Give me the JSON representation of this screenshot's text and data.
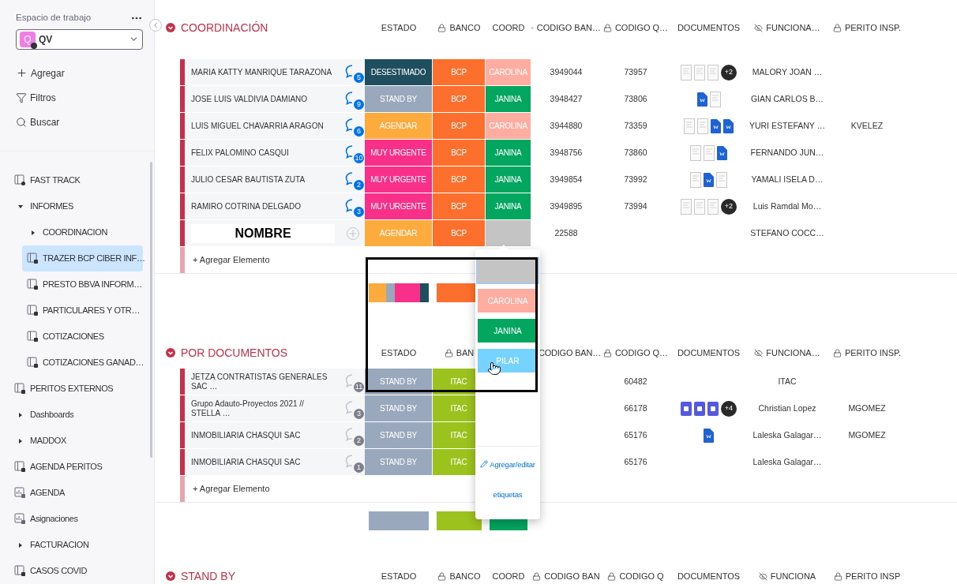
{
  "sidebar": {
    "workspace_label": "Espacio de trabajo",
    "workspace": {
      "initial": "Q",
      "name": "QV"
    },
    "actions": [
      {
        "kind": "add",
        "label": "Agregar"
      },
      {
        "kind": "filter",
        "label": "Filtros"
      },
      {
        "kind": "search",
        "label": "Buscar"
      }
    ],
    "items": [
      {
        "kind": "shared_board",
        "label": "FAST TRACK",
        "selected": false
      },
      {
        "kind": "folder",
        "label": "INFORMES",
        "expanded": true,
        "selected": false,
        "children": [
          {
            "kind": "folder",
            "label": "COORDINACION",
            "expanded": false,
            "selected": false
          },
          {
            "kind": "board",
            "label": "TRAZER BCP CIBER INF…",
            "selected": true
          },
          {
            "kind": "board",
            "label": "PRESTO BBVA INFORM…",
            "selected": false
          },
          {
            "kind": "board",
            "label": "PARTICULARES Y OTR…",
            "selected": false
          },
          {
            "kind": "board",
            "label": "COTIZACIONES",
            "selected": false
          },
          {
            "kind": "board",
            "label": "COTIZACIONES GANAD…",
            "selected": false
          }
        ]
      },
      {
        "kind": "board",
        "label": "PERITOS EXTERNOS",
        "selected": false
      },
      {
        "kind": "folder",
        "label": "Dashboards",
        "expanded": false,
        "selected": false
      },
      {
        "kind": "folder",
        "label": "MADDOX",
        "expanded": false,
        "selected": false
      },
      {
        "kind": "board",
        "label": "AGENDA PERITOS",
        "selected": false
      },
      {
        "kind": "dashboard",
        "label": "AGENDA",
        "selected": false
      },
      {
        "kind": "dashboard",
        "label": "Asignaciones",
        "selected": false
      },
      {
        "kind": "folder",
        "label": "FACTURACION",
        "expanded": false,
        "selected": false
      },
      {
        "kind": "board",
        "label": "CASOS COVID",
        "selected": false
      }
    ]
  },
  "groups": [
    {
      "title": "COORDINACIÓN",
      "color": "#c4314b",
      "columns": [
        {
          "label": "ESTADO",
          "locked": false,
          "hidden": false
        },
        {
          "label": "BANCO",
          "locked": true,
          "hidden": false
        },
        {
          "label": "COORD",
          "locked": false,
          "hidden": false
        },
        {
          "label": "CODIGO BAN…",
          "locked": true,
          "hidden": false
        },
        {
          "label": "CODIGO Q…",
          "locked": true,
          "hidden": false
        },
        {
          "label": "DOCUMENTOS",
          "locked": false,
          "hidden": false
        },
        {
          "label": "FUNCIONA…",
          "locked": false,
          "hidden": true
        },
        {
          "label": "PERITO INSP.",
          "locked": true,
          "hidden": false
        }
      ],
      "rows": [
        {
          "name": "MARIA KATTY MANRIQUE TARAZONA",
          "editing": false,
          "comments": {
            "count": "5",
            "active": true
          },
          "estado": {
            "label": "DESESTIMADO",
            "color": "#1f4e5f"
          },
          "banco": {
            "label": "BCP",
            "color": "#fd6f2c"
          },
          "coord": {
            "label": "CAROLINA",
            "color": "#ffada1"
          },
          "codigo_ban": "3949044",
          "codigo_q": "73957",
          "docs": [
            {
              "kind": "page"
            },
            {
              "kind": "page"
            },
            {
              "kind": "page"
            }
          ],
          "docs_more": "+2",
          "funcionario": "MALORY JOAN …"
        },
        {
          "name": "JOSE LUIS VALDIVIA DAMIANO",
          "editing": false,
          "comments": {
            "count": "9",
            "active": true
          },
          "estado": {
            "label": "STAND BY",
            "color": "#9aa8bd"
          },
          "banco": {
            "label": "BCP",
            "color": "#fd6f2c"
          },
          "coord": {
            "label": "JANINA",
            "color": "#03a65f"
          },
          "codigo_ban": "3948427",
          "codigo_q": "73806",
          "docs": [
            {
              "kind": "word"
            },
            {
              "kind": "page"
            }
          ],
          "funcionario": "GIAN CARLOS B…"
        },
        {
          "name": "LUIS MIGUEL CHAVARRIA ARAGON",
          "editing": false,
          "comments": {
            "count": "6",
            "active": true
          },
          "estado": {
            "label": "AGENDAR",
            "color": "#fdab3d"
          },
          "banco": {
            "label": "BCP",
            "color": "#fd6f2c"
          },
          "coord": {
            "label": "CAROLINA",
            "color": "#ffada1"
          },
          "codigo_ban": "3944880",
          "codigo_q": "73359",
          "docs": [
            {
              "kind": "page"
            },
            {
              "kind": "page"
            },
            {
              "kind": "word"
            },
            {
              "kind": "word"
            }
          ],
          "funcionario": "YURI ESTEFANY …",
          "perito": "KVELEZ"
        },
        {
          "name": "FELIX PALOMINO CASQUI",
          "editing": false,
          "comments": {
            "count": "10",
            "active": true
          },
          "estado": {
            "label": "MUY URGENTE",
            "color": "#f9308a"
          },
          "banco": {
            "label": "BCP",
            "color": "#fd6f2c"
          },
          "coord": {
            "label": "JANINA",
            "color": "#03a65f"
          },
          "codigo_ban": "3948756",
          "codigo_q": "73860",
          "docs": [
            {
              "kind": "page"
            },
            {
              "kind": "page"
            },
            {
              "kind": "word"
            }
          ],
          "funcionario": "FERNANDO JUN…"
        },
        {
          "name": "JULIO CESAR BAUTISTA ZUTA",
          "editing": false,
          "comments": {
            "count": "2",
            "active": true
          },
          "estado": {
            "label": "MUY URGENTE",
            "color": "#f9308a"
          },
          "banco": {
            "label": "BCP",
            "color": "#fd6f2c"
          },
          "coord": {
            "label": "JANINA",
            "color": "#03a65f"
          },
          "codigo_ban": "3949854",
          "codigo_q": "73992",
          "docs": [
            {
              "kind": "page"
            },
            {
              "kind": "word"
            },
            {
              "kind": "page"
            }
          ],
          "funcionario": "YAMALI ISELA D…"
        },
        {
          "name": "RAMIRO COTRINA DELGADO",
          "editing": false,
          "comments": {
            "count": "3",
            "active": true
          },
          "estado": {
            "label": "MUY URGENTE",
            "color": "#f9308a"
          },
          "banco": {
            "label": "BCP",
            "color": "#fd6f2c"
          },
          "coord": {
            "label": "JANINA",
            "color": "#03a65f"
          },
          "codigo_ban": "3949895",
          "codigo_q": "73994",
          "docs": [
            {
              "kind": "page"
            },
            {
              "kind": "page"
            },
            {
              "kind": "page"
            }
          ],
          "docs_more": "+2",
          "funcionario": "Luis Ramdal Mo…"
        },
        {
          "name": "NOMBRE",
          "editing": true,
          "estado": {
            "label": "AGENDAR",
            "color": "#fdab3d"
          },
          "banco": {
            "label": "BCP",
            "color": "#fd6f2c"
          },
          "coord": {
            "color": "#c4c4c4"
          },
          "codigo_ban": "22588",
          "funcionario": "STEFANO COCC…"
        }
      ],
      "add_label": "+ Agregar Elemento",
      "summary": {
        "estado": [
          {
            "color": "#fdab3d"
          },
          {
            "color": "#9aa8bd"
          },
          {
            "color": "#f9308a"
          },
          {
            "color": "#1f4e5f"
          }
        ],
        "banco": [
          {
            "color": "#fd6f2c"
          }
        ]
      }
    },
    {
      "title": "POR DOCUMENTOS",
      "color": "#c4314b",
      "columns": [
        {
          "label": "ESTADO",
          "locked": false,
          "hidden": false
        },
        {
          "label": "BAN",
          "locked": true,
          "hidden": false
        },
        {
          "label": "CODIGO BAN…"
        },
        {
          "label": "CODIGO Q…",
          "locked": true,
          "hidden": false
        },
        {
          "label": "DOCUMENTOS",
          "locked": false,
          "hidden": false
        },
        {
          "label": "FUNCIONA…",
          "locked": false,
          "hidden": true
        },
        {
          "label": "PERITO INSP.",
          "locked": true,
          "hidden": false
        }
      ],
      "rows": [
        {
          "name": "JETZA CONTRATISTAS GENERALES SAC …",
          "editing": false,
          "comments": {
            "count": "11",
            "active": false
          },
          "estado": {
            "label": "STAND BY",
            "color": "#9aa8bd"
          },
          "banco": {
            "label": "ITAC",
            "color": "#9cc21d"
          },
          "codigo_q": "60482",
          "funcionario": "ITAC"
        },
        {
          "name": "Grupo Adauto-Proyectos 2021 // STELLA …",
          "editing": false,
          "comments": {
            "count": "3",
            "active": false
          },
          "estado": {
            "label": "STAND BY",
            "color": "#9aa8bd"
          },
          "banco": {
            "label": "ITAC",
            "color": "#9cc21d"
          },
          "codigo_q": "66178",
          "docs": [
            {
              "kind": "gdoc"
            },
            {
              "kind": "gdoc"
            },
            {
              "kind": "gdoc"
            }
          ],
          "docs_more": "+4",
          "funcionario": "Christian Lopez",
          "perito": "MGOMEZ"
        },
        {
          "name": "INMOBILIARIA CHASQUI SAC",
          "editing": false,
          "comments": {
            "count": "2",
            "active": false
          },
          "estado": {
            "label": "STAND BY",
            "color": "#9aa8bd"
          },
          "banco": {
            "label": "ITAC",
            "color": "#9cc21d"
          },
          "codigo_q": "65176",
          "docs": [
            {
              "kind": "word"
            }
          ],
          "funcionario": "Laleska Galagar…",
          "perito": "MGOMEZ"
        },
        {
          "name": "INMOBILIARIA CHASQUI SAC",
          "editing": false,
          "comments": {
            "count": "1",
            "active": false
          },
          "estado": {
            "label": "STAND BY",
            "color": "#9aa8bd"
          },
          "banco": {
            "label": "ITAC",
            "color": "#9cc21d"
          },
          "codigo_q": "65176",
          "funcionario": "Laleska Galagar…"
        }
      ],
      "add_label": "+ Agregar Elemento",
      "summary": {
        "estado": [
          {
            "color": "#9aa8bd"
          }
        ],
        "banco": [
          {
            "color": "#9cc21d"
          }
        ],
        "coord": [
          {
            "color": "#03a65f"
          }
        ]
      }
    },
    {
      "title": "STAND BY",
      "color": "#c4314b",
      "columns": [
        {
          "label": "ESTADO",
          "locked": false,
          "hidden": false
        },
        {
          "label": "BANCO",
          "locked": true,
          "hidden": false
        },
        {
          "label": "COORD",
          "locked": false,
          "hidden": false
        },
        {
          "label": "CODIGO BAN",
          "locked": true,
          "hidden": false
        },
        {
          "label": "CODIGO Q",
          "locked": true,
          "hidden": false
        },
        {
          "label": "DOCUMENTOS",
          "locked": false,
          "hidden": false
        },
        {
          "label": "FUNCIONA",
          "locked": false,
          "hidden": true
        },
        {
          "label": "PERITO INSP",
          "locked": true,
          "hidden": false
        }
      ]
    }
  ],
  "label_picker": {
    "options": [
      {
        "color": "#c4c4c4",
        "selected": true,
        "hovered": false
      },
      {
        "label": "CAROLINA",
        "color": "#ffada1",
        "selected": false,
        "hovered": false
      },
      {
        "label": "JANINA",
        "color": "#03a65f",
        "selected": false,
        "hovered": false
      },
      {
        "label": "PILAR",
        "color": "#70c8fa",
        "selected": false,
        "hovered": true
      }
    ],
    "edit_link": "Agregar/editar etiquetas"
  },
  "highlight_frame": true
}
